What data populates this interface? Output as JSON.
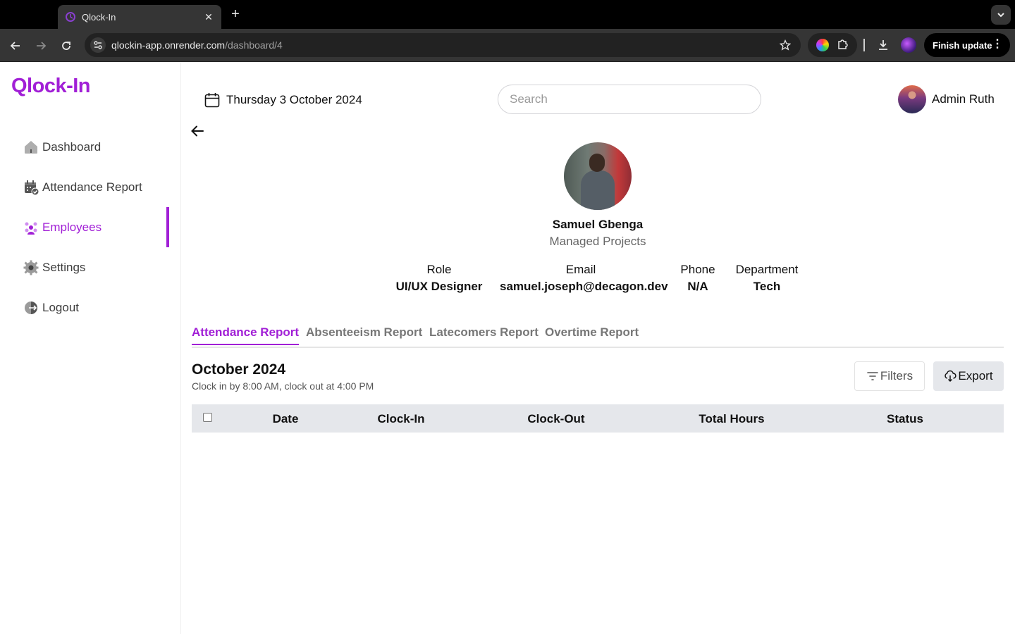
{
  "browser": {
    "tab_title": "Qlock-In",
    "url_host": "qlockin-app.onrender.com",
    "url_path": "/dashboard/4",
    "finish_update_label": "Finish update"
  },
  "app": {
    "logo": "Qlock-In",
    "accent_color": "#a11fd6"
  },
  "sidebar": {
    "items": [
      {
        "label": "Dashboard",
        "icon": "home-icon",
        "active": false
      },
      {
        "label": "Attendance Report",
        "icon": "calendar-check-icon",
        "active": false
      },
      {
        "label": "Employees",
        "icon": "users-icon",
        "active": true
      },
      {
        "label": "Settings",
        "icon": "gear-icon",
        "active": false
      },
      {
        "label": "Logout",
        "icon": "logout-icon",
        "active": false
      }
    ]
  },
  "header": {
    "date": "Thursday 3 October 2024",
    "search_placeholder": "Search",
    "user_name": "Admin Ruth"
  },
  "employee": {
    "name": "Samuel Gbenga",
    "subtitle": "Managed Projects",
    "fields": [
      {
        "label": "Role",
        "value": "UI/UX Designer"
      },
      {
        "label": "Email",
        "value": "samuel.joseph@decagon.dev"
      },
      {
        "label": "Phone",
        "value": "N/A"
      },
      {
        "label": "Department",
        "value": "Tech"
      }
    ]
  },
  "report_tabs": [
    {
      "label": "Attendance Report",
      "active": true
    },
    {
      "label": "Absenteeism Report",
      "active": false
    },
    {
      "label": "Latecomers Report",
      "active": false
    },
    {
      "label": "Overtime Report",
      "active": false
    }
  ],
  "report": {
    "period": "October 2024",
    "policy": "Clock in by 8:00 AM, clock out at 4:00 PM",
    "filters_label": "Filters",
    "export_label": "Export",
    "columns": [
      "Date",
      "Clock-In",
      "Clock-Out",
      "Total Hours",
      "Status"
    ]
  }
}
